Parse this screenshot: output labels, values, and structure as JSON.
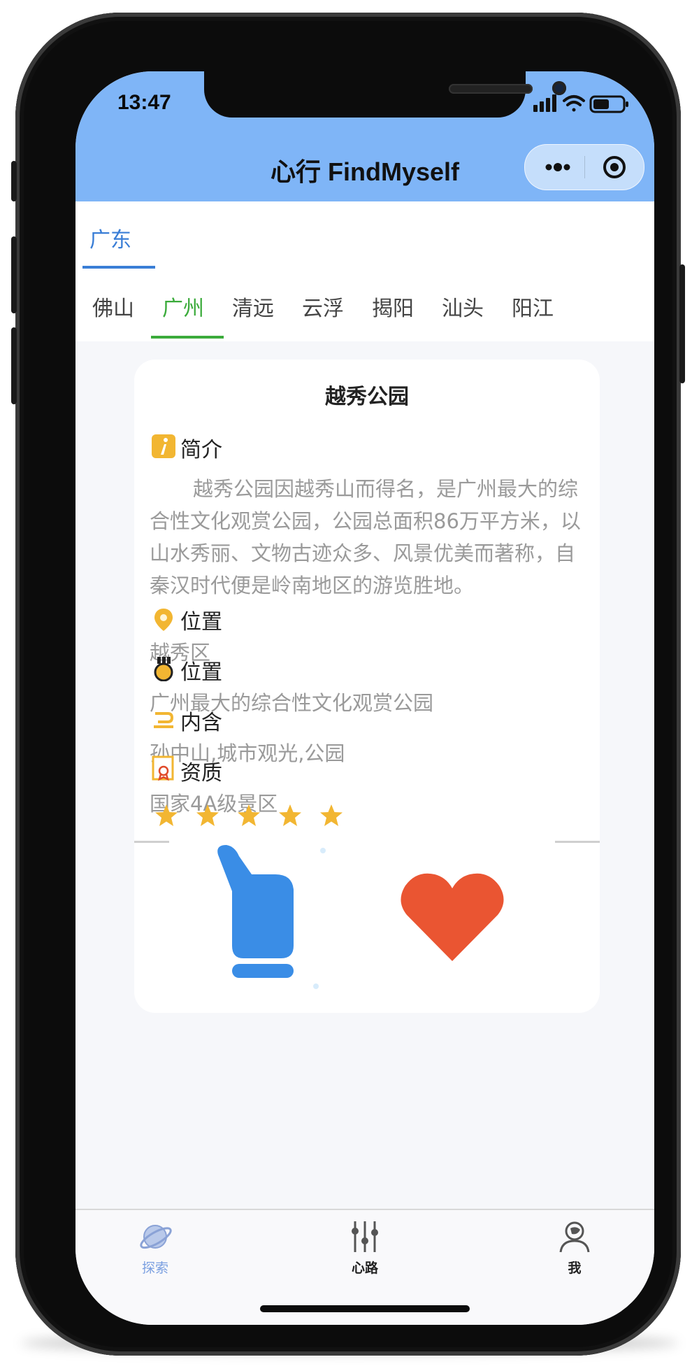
{
  "status_bar": {
    "time": "13:47"
  },
  "nav": {
    "title": "心行 FindMyself"
  },
  "provinces": [
    {
      "label": "广东",
      "active": true
    }
  ],
  "cities": [
    {
      "label": "佛山"
    },
    {
      "label": "广州"
    },
    {
      "label": "清远"
    },
    {
      "label": "云浮"
    },
    {
      "label": "揭阳"
    },
    {
      "label": "汕头"
    },
    {
      "label": "阳江"
    }
  ],
  "active_city": "广州",
  "card": {
    "title": "越秀公园",
    "intro_label": "简介",
    "intro_text": "越秀公园因越秀山而得名，是广州最大的综合性文化观赏公园，公园总面积86万平方米，以山水秀丽、文物古迹众多、风景优美而著称，自秦汉时代便是岭南地区的游览胜地。",
    "location_label": "位置",
    "location_value": "越秀区",
    "feature_label": "位置",
    "feature_value": "广州最大的综合性文化观赏公园",
    "contains_label": "内含",
    "contains_value": "孙中山,城市观光,公园",
    "qualification_label": "资质",
    "qualification_value": "国家4A级景区",
    "rating": 5,
    "rating_max": 5
  },
  "tabbar": {
    "items": [
      {
        "label": "探索",
        "active": true
      },
      {
        "label": "心路",
        "active": false
      },
      {
        "label": "我",
        "active": false
      }
    ]
  },
  "colors": {
    "header_bg": "#7fb5f7",
    "province_active": "#3a7ed6",
    "city_active": "#3bab3b",
    "star": "#f2b632",
    "thumb": "#3a8de6",
    "heart": "#ea5532",
    "tab_active": "#7a9fe0"
  }
}
